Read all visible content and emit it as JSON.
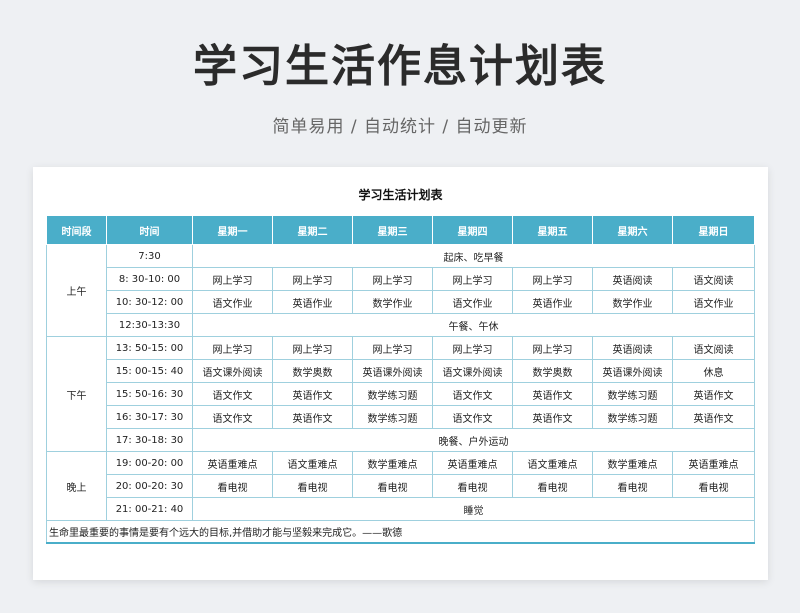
{
  "header": {
    "title": "学习生活作息计划表",
    "subtitle": "简单易用 / 自动统计 / 自动更新"
  },
  "sheet": {
    "title": "学习生活计划表",
    "columns": [
      "时间段",
      "时间",
      "星期一",
      "星期二",
      "星期三",
      "星期四",
      "星期五",
      "星期六",
      "星期日"
    ],
    "periods": {
      "morning": "上午",
      "afternoon": "下午",
      "evening": "晚上"
    },
    "rows": [
      {
        "time": "7:30",
        "merged": "起床、吃早餐"
      },
      {
        "time": "8: 30-10: 00",
        "cells": [
          "网上学习",
          "网上学习",
          "网上学习",
          "网上学习",
          "网上学习",
          "英语阅读",
          "语文阅读"
        ]
      },
      {
        "time": "10: 30-12: 00",
        "cells": [
          "语文作业",
          "英语作业",
          "数学作业",
          "语文作业",
          "英语作业",
          "数学作业",
          "语文作业"
        ]
      },
      {
        "time": "12:30-13:30",
        "merged": "午餐、午休"
      },
      {
        "time": "13: 50-15: 00",
        "cells": [
          "网上学习",
          "网上学习",
          "网上学习",
          "网上学习",
          "网上学习",
          "英语阅读",
          "语文阅读"
        ]
      },
      {
        "time": "15: 00-15: 40",
        "cells": [
          "语文课外阅读",
          "数学奥数",
          "英语课外阅读",
          "语文课外阅读",
          "数学奥数",
          "英语课外阅读",
          "休息"
        ]
      },
      {
        "time": "15: 50-16: 30",
        "cells": [
          "语文作文",
          "英语作文",
          "数学练习题",
          "语文作文",
          "英语作文",
          "数学练习题",
          "英语作文"
        ]
      },
      {
        "time": "16: 30-17: 30",
        "cells": [
          "语文作文",
          "英语作文",
          "数学练习题",
          "语文作文",
          "英语作文",
          "数学练习题",
          "英语作文"
        ]
      },
      {
        "time": "17: 30-18: 30",
        "merged": "晚餐、户外运动"
      },
      {
        "time": "19: 00-20: 00",
        "cells": [
          "英语重难点",
          "语文重难点",
          "数学重难点",
          "英语重难点",
          "语文重难点",
          "数学重难点",
          "英语重难点"
        ]
      },
      {
        "time": "20: 00-20: 30",
        "cells": [
          "看电视",
          "看电视",
          "看电视",
          "看电视",
          "看电视",
          "看电视",
          "看电视"
        ]
      },
      {
        "time": "21: 00-21: 40",
        "merged": "睡觉"
      }
    ],
    "quote": "生命里最重要的事情是要有个远大的目标,并借助才能与坚毅来完成它。——歌德"
  },
  "colors": {
    "header_bg": "#4aaec9",
    "grid_line": "#9fd0de"
  }
}
